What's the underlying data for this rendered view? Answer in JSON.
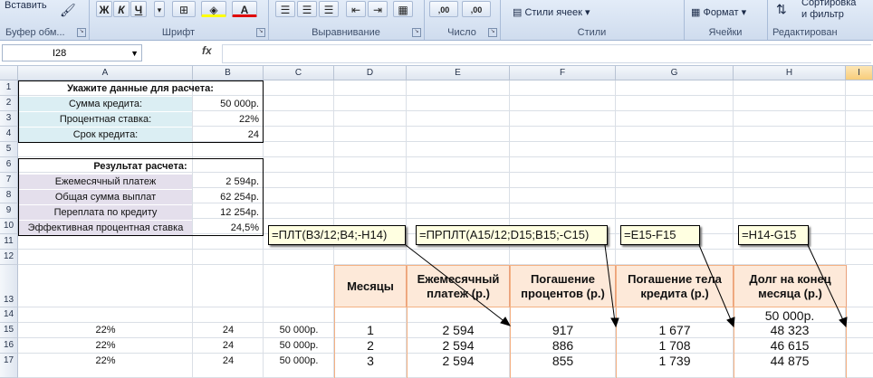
{
  "ribbon": {
    "paste_label": "Вставить",
    "clipboard_label": "Буфер обм...",
    "font_label": "Шрифт",
    "align_label": "Выравнивание",
    "number_label": "Число",
    "styles_label": "Стили",
    "cells_label": "Ячейки",
    "editing_label": "Редактирован",
    "cell_styles": "Стили ячеек",
    "format_btn": "Формат",
    "sort_btn_1": "Сортировка",
    "sort_btn_2": "и фильтр",
    "bold": "Ж",
    "italic": "К",
    "underline": "Ч",
    "num_inc": "‚00",
    "num_dec": ",00"
  },
  "formula_bar": {
    "name_box": "I28",
    "fx": "fx",
    "formula": ""
  },
  "columns": [
    "A",
    "B",
    "C",
    "D",
    "E",
    "F",
    "G",
    "H",
    "I"
  ],
  "rows": [
    "1",
    "2",
    "3",
    "4",
    "5",
    "6",
    "7",
    "8",
    "9",
    "10",
    "11",
    "12",
    "13",
    "14",
    "15",
    "16",
    "17"
  ],
  "input": {
    "title": "Укажите данные для расчета:",
    "loan_label": "Сумма кредита:",
    "loan_value": "50 000р.",
    "rate_label": "Процентная ставка:",
    "rate_value": "22%",
    "term_label": "Срок кредита:",
    "term_value": "24"
  },
  "result": {
    "title": "Результат расчета:",
    "monthly_label": "Ежемесячный платеж",
    "monthly_value": "2 594р.",
    "total_label": "Общая сумма выплат",
    "total_value": "62 254р.",
    "over_label": "Переплата по кредиту",
    "over_value": "12 254р.",
    "eff_label": "Эффективная процентная ставка",
    "eff_value": "24,5%"
  },
  "table": {
    "headers": [
      "Месяцы",
      "Ежемесячный платеж (р.)",
      "Погашение процентов (р.)",
      "Погашение тела кредита (р.)",
      "Долг на конец месяца (р.)"
    ],
    "start_balance": "50 000р.",
    "rows": [
      {
        "a": "22%",
        "b": "24",
        "c": "50 000р.",
        "d": "1",
        "e": "2 594",
        "f": "917",
        "g": "1 677",
        "h": "48 323"
      },
      {
        "a": "22%",
        "b": "24",
        "c": "50 000р.",
        "d": "2",
        "e": "2 594",
        "f": "886",
        "g": "1 708",
        "h": "46 615"
      },
      {
        "a": "22%",
        "b": "24",
        "c": "50 000р.",
        "d": "3",
        "e": "2 594",
        "f": "855",
        "g": "1 739",
        "h": "44 875"
      }
    ]
  },
  "notes": {
    "pmt": "=ПЛТ(B3/12;B4;-H14)",
    "ipmt": "=ПРПЛТ(A15/12;D15;B15;-C15)",
    "principal": "=E15-F15",
    "debt": "=H14-G15"
  }
}
